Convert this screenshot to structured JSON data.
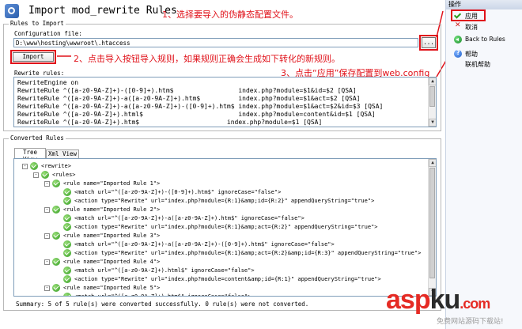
{
  "window": {
    "title": "Import mod_rewrite Rules"
  },
  "annotations": [
    "1、选择要导入的伪静态配置文件。",
    "2、点击导入按钮导入规则，如果规则正确会生成如下转化的新规则。",
    "3、点击“应用”保存配置到web.config"
  ],
  "import_group": {
    "legend": "Rules to Import",
    "config_label": "Configuration file:",
    "config_value": "D:\\www\\hosting\\wwwroot\\.htaccess",
    "browse_label": "...",
    "import_label": "Import",
    "rewrite_label": "Rewrite rules:",
    "rewrite_lines": [
      "RewriteEngine on",
      "RewriteRule ^([a-z0-9A-Z]+)-([0-9]+).htm$                 index.php?module=$1&id=$2 [QSA]",
      "RewriteRule ^([a-z0-9A-Z]+)-a([a-z0-9A-Z]+).htm$          index.php?module=$1&act=$2 [QSA]",
      "RewriteRule ^([a-z0-9A-Z]+)-a([a-z0-9A-Z]+)-([0-9]+).htm$ index.php?module=$1&act=$2&id=$3 [QSA]",
      "RewriteRule ^([a-z0-9A-Z]+).html$                         index.php?module=content&id=$1 [QSA]",
      "RewriteRule ^([a-z0-9A-Z]+).htm$                       index.php?module=$1 [QSA]"
    ]
  },
  "converted_group": {
    "legend": "Converted Rules",
    "tabs": [
      "Tree View",
      "Xml View"
    ],
    "tree": [
      {
        "depth": 0,
        "expander": "-",
        "text": "<rewrite>"
      },
      {
        "depth": 1,
        "expander": "-",
        "text": "<rules>"
      },
      {
        "depth": 2,
        "expander": "-",
        "text": "<rule name=\"Imported Rule 1\">"
      },
      {
        "depth": 3,
        "expander": "",
        "text": "<match url=\"^([a-z0-9A-Z]+)-([0-9]+).htm$\" ignoreCase=\"false\">"
      },
      {
        "depth": 3,
        "expander": "",
        "text": "<action type=\"Rewrite\" url=\"index.php?module={R:1}&amp;id={R:2}\" appendQueryString=\"true\">"
      },
      {
        "depth": 2,
        "expander": "-",
        "text": "<rule name=\"Imported Rule 2\">"
      },
      {
        "depth": 3,
        "expander": "",
        "text": "<match url=\"^([a-z0-9A-Z]+)-a([a-z0-9A-Z]+).htm$\" ignoreCase=\"false\">"
      },
      {
        "depth": 3,
        "expander": "",
        "text": "<action type=\"Rewrite\" url=\"index.php?module={R:1}&amp;act={R:2}\" appendQueryString=\"true\">"
      },
      {
        "depth": 2,
        "expander": "-",
        "text": "<rule name=\"Imported Rule 3\">"
      },
      {
        "depth": 3,
        "expander": "",
        "text": "<match url=\"^([a-z0-9A-Z]+)-a([a-z0-9A-Z]+)-([0-9]+).htm$\" ignoreCase=\"false\">"
      },
      {
        "depth": 3,
        "expander": "",
        "text": "<action type=\"Rewrite\" url=\"index.php?module={R:1}&amp;act={R:2}&amp;id={R:3}\" appendQueryString=\"true\">"
      },
      {
        "depth": 2,
        "expander": "-",
        "text": "<rule name=\"Imported Rule 4\">"
      },
      {
        "depth": 3,
        "expander": "",
        "text": "<match url=\"^([a-z0-9A-Z]+).html$\" ignoreCase=\"false\">"
      },
      {
        "depth": 3,
        "expander": "",
        "text": "<action type=\"Rewrite\" url=\"index.php?module=content&amp;id={R:1}\" appendQueryString=\"true\">"
      },
      {
        "depth": 2,
        "expander": "-",
        "text": "<rule name=\"Imported Rule 5\">"
      },
      {
        "depth": 3,
        "expander": "",
        "text": "<match url=\"^([a-z0-9A-Z]+).htm$\" ignoreCase=\"false\">"
      }
    ],
    "summary": "Summary: 5 of 5 rule(s) were converted successfully. 0 rule(s) were not converted."
  },
  "actions": {
    "header": "操作",
    "apply": "应用",
    "cancel": "取消",
    "back": "Back to Rules",
    "help": "帮助",
    "online_help": "联机帮助"
  },
  "watermark": {
    "brand_a": "asp",
    "brand_b": "ku",
    "brand_c": ".com",
    "tagline": "免费网站源码下载站!"
  },
  "colors": {
    "annotation": "#e0121a",
    "ok": "#2f9a1f"
  },
  "icons": {
    "title": "rewrite-module-icon",
    "node": "check-circle-icon",
    "help": "help-icon",
    "back": "back-arrow-icon",
    "apply": "apply-check-icon",
    "cancel": "cancel-x-icon"
  }
}
